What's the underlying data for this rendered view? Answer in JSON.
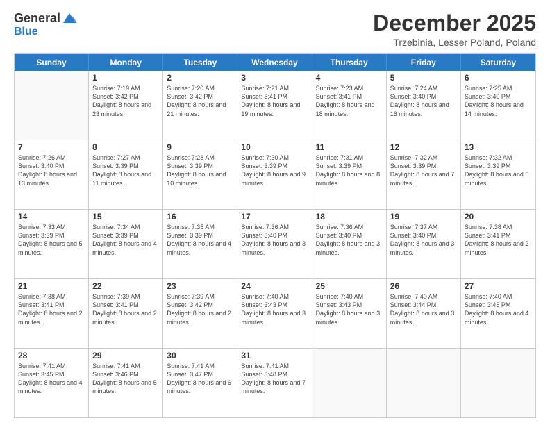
{
  "logo": {
    "general": "General",
    "blue": "Blue"
  },
  "title": "December 2025",
  "location": "Trzebinia, Lesser Poland, Poland",
  "days": [
    "Sunday",
    "Monday",
    "Tuesday",
    "Wednesday",
    "Thursday",
    "Friday",
    "Saturday"
  ],
  "rows": [
    [
      {
        "day": "",
        "sunrise": "",
        "sunset": "",
        "daylight": "",
        "empty": true
      },
      {
        "day": "1",
        "sunrise": "Sunrise: 7:19 AM",
        "sunset": "Sunset: 3:42 PM",
        "daylight": "Daylight: 8 hours and 23 minutes."
      },
      {
        "day": "2",
        "sunrise": "Sunrise: 7:20 AM",
        "sunset": "Sunset: 3:42 PM",
        "daylight": "Daylight: 8 hours and 21 minutes."
      },
      {
        "day": "3",
        "sunrise": "Sunrise: 7:21 AM",
        "sunset": "Sunset: 3:41 PM",
        "daylight": "Daylight: 8 hours and 19 minutes."
      },
      {
        "day": "4",
        "sunrise": "Sunrise: 7:23 AM",
        "sunset": "Sunset: 3:41 PM",
        "daylight": "Daylight: 8 hours and 18 minutes."
      },
      {
        "day": "5",
        "sunrise": "Sunrise: 7:24 AM",
        "sunset": "Sunset: 3:40 PM",
        "daylight": "Daylight: 8 hours and 16 minutes."
      },
      {
        "day": "6",
        "sunrise": "Sunrise: 7:25 AM",
        "sunset": "Sunset: 3:40 PM",
        "daylight": "Daylight: 8 hours and 14 minutes."
      }
    ],
    [
      {
        "day": "7",
        "sunrise": "Sunrise: 7:26 AM",
        "sunset": "Sunset: 3:40 PM",
        "daylight": "Daylight: 8 hours and 13 minutes."
      },
      {
        "day": "8",
        "sunrise": "Sunrise: 7:27 AM",
        "sunset": "Sunset: 3:39 PM",
        "daylight": "Daylight: 8 hours and 11 minutes."
      },
      {
        "day": "9",
        "sunrise": "Sunrise: 7:28 AM",
        "sunset": "Sunset: 3:39 PM",
        "daylight": "Daylight: 8 hours and 10 minutes."
      },
      {
        "day": "10",
        "sunrise": "Sunrise: 7:30 AM",
        "sunset": "Sunset: 3:39 PM",
        "daylight": "Daylight: 8 hours and 9 minutes."
      },
      {
        "day": "11",
        "sunrise": "Sunrise: 7:31 AM",
        "sunset": "Sunset: 3:39 PM",
        "daylight": "Daylight: 8 hours and 8 minutes."
      },
      {
        "day": "12",
        "sunrise": "Sunrise: 7:32 AM",
        "sunset": "Sunset: 3:39 PM",
        "daylight": "Daylight: 8 hours and 7 minutes."
      },
      {
        "day": "13",
        "sunrise": "Sunrise: 7:32 AM",
        "sunset": "Sunset: 3:39 PM",
        "daylight": "Daylight: 8 hours and 6 minutes."
      }
    ],
    [
      {
        "day": "14",
        "sunrise": "Sunrise: 7:33 AM",
        "sunset": "Sunset: 3:39 PM",
        "daylight": "Daylight: 8 hours and 5 minutes."
      },
      {
        "day": "15",
        "sunrise": "Sunrise: 7:34 AM",
        "sunset": "Sunset: 3:39 PM",
        "daylight": "Daylight: 8 hours and 4 minutes."
      },
      {
        "day": "16",
        "sunrise": "Sunrise: 7:35 AM",
        "sunset": "Sunset: 3:39 PM",
        "daylight": "Daylight: 8 hours and 4 minutes."
      },
      {
        "day": "17",
        "sunrise": "Sunrise: 7:36 AM",
        "sunset": "Sunset: 3:40 PM",
        "daylight": "Daylight: 8 hours and 3 minutes."
      },
      {
        "day": "18",
        "sunrise": "Sunrise: 7:36 AM",
        "sunset": "Sunset: 3:40 PM",
        "daylight": "Daylight: 8 hours and 3 minutes."
      },
      {
        "day": "19",
        "sunrise": "Sunrise: 7:37 AM",
        "sunset": "Sunset: 3:40 PM",
        "daylight": "Daylight: 8 hours and 3 minutes."
      },
      {
        "day": "20",
        "sunrise": "Sunrise: 7:38 AM",
        "sunset": "Sunset: 3:41 PM",
        "daylight": "Daylight: 8 hours and 2 minutes."
      }
    ],
    [
      {
        "day": "21",
        "sunrise": "Sunrise: 7:38 AM",
        "sunset": "Sunset: 3:41 PM",
        "daylight": "Daylight: 8 hours and 2 minutes."
      },
      {
        "day": "22",
        "sunrise": "Sunrise: 7:39 AM",
        "sunset": "Sunset: 3:41 PM",
        "daylight": "Daylight: 8 hours and 2 minutes."
      },
      {
        "day": "23",
        "sunrise": "Sunrise: 7:39 AM",
        "sunset": "Sunset: 3:42 PM",
        "daylight": "Daylight: 8 hours and 2 minutes."
      },
      {
        "day": "24",
        "sunrise": "Sunrise: 7:40 AM",
        "sunset": "Sunset: 3:43 PM",
        "daylight": "Daylight: 8 hours and 3 minutes."
      },
      {
        "day": "25",
        "sunrise": "Sunrise: 7:40 AM",
        "sunset": "Sunset: 3:43 PM",
        "daylight": "Daylight: 8 hours and 3 minutes."
      },
      {
        "day": "26",
        "sunrise": "Sunrise: 7:40 AM",
        "sunset": "Sunset: 3:44 PM",
        "daylight": "Daylight: 8 hours and 3 minutes."
      },
      {
        "day": "27",
        "sunrise": "Sunrise: 7:40 AM",
        "sunset": "Sunset: 3:45 PM",
        "daylight": "Daylight: 8 hours and 4 minutes."
      }
    ],
    [
      {
        "day": "28",
        "sunrise": "Sunrise: 7:41 AM",
        "sunset": "Sunset: 3:45 PM",
        "daylight": "Daylight: 8 hours and 4 minutes."
      },
      {
        "day": "29",
        "sunrise": "Sunrise: 7:41 AM",
        "sunset": "Sunset: 3:46 PM",
        "daylight": "Daylight: 8 hours and 5 minutes."
      },
      {
        "day": "30",
        "sunrise": "Sunrise: 7:41 AM",
        "sunset": "Sunset: 3:47 PM",
        "daylight": "Daylight: 8 hours and 6 minutes."
      },
      {
        "day": "31",
        "sunrise": "Sunrise: 7:41 AM",
        "sunset": "Sunset: 3:48 PM",
        "daylight": "Daylight: 8 hours and 7 minutes."
      },
      {
        "day": "",
        "sunrise": "",
        "sunset": "",
        "daylight": "",
        "empty": true
      },
      {
        "day": "",
        "sunrise": "",
        "sunset": "",
        "daylight": "",
        "empty": true
      },
      {
        "day": "",
        "sunrise": "",
        "sunset": "",
        "daylight": "",
        "empty": true
      }
    ]
  ]
}
